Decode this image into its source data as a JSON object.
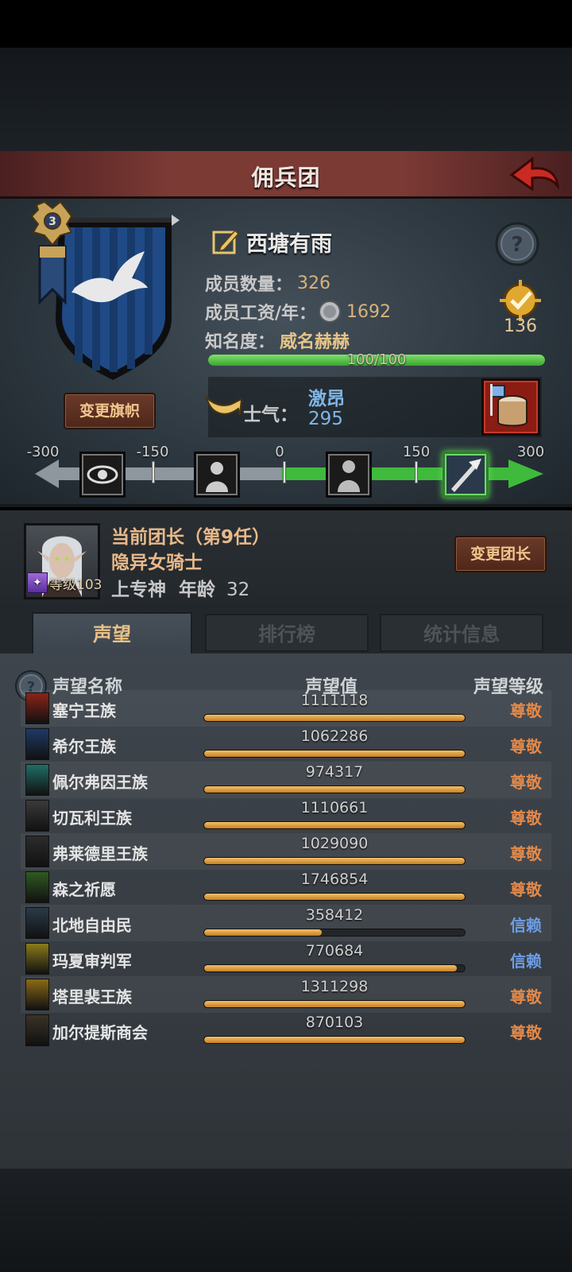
{
  "header": {
    "title": "佣兵团"
  },
  "guild": {
    "name": "西塘有雨",
    "members_label": "成员数量：",
    "members_value": "326",
    "salary_label": "成员工资/年：",
    "salary_value": "1692",
    "fame_label": "知名度：",
    "fame_value": "威名赫赫",
    "fame_progress_text": "100/100",
    "fame_progress": 1.0,
    "quest_count": "136",
    "change_flag_label": "变更旗帜",
    "banner_rank": "3"
  },
  "morale": {
    "label": "士气：",
    "state": "激昂",
    "value": "295",
    "scale_labels": [
      "-300",
      "-150",
      "0",
      "150",
      "300"
    ]
  },
  "leader": {
    "title": "当前团长（第9任）",
    "name": "隐异女骑士",
    "level_text": "等级103",
    "belief": "上专神",
    "age_label": "年龄",
    "age_value": "32",
    "change_leader_label": "变更团长"
  },
  "tabs": [
    {
      "label": "声望",
      "active": true
    },
    {
      "label": "排行榜",
      "active": false
    },
    {
      "label": "统计信息",
      "active": false
    }
  ],
  "reputation": {
    "columns": [
      "声望名称",
      "声望值",
      "声望等级"
    ],
    "rows": [
      {
        "name": "塞宁王族",
        "value": "1111118",
        "level": "尊敬",
        "fill": 1.0,
        "crest_color": "#8a2418"
      },
      {
        "name": "希尔王族",
        "value": "1062286",
        "level": "尊敬",
        "fill": 1.0,
        "crest_color": "#1e3a66"
      },
      {
        "name": "佩尔弗因王族",
        "value": "974317",
        "level": "尊敬",
        "fill": 1.0,
        "crest_color": "#1f6e66"
      },
      {
        "name": "切瓦利王族",
        "value": "1110661",
        "level": "尊敬",
        "fill": 1.0,
        "crest_color": "#3a3a3a"
      },
      {
        "name": "弗莱德里王族",
        "value": "1029090",
        "level": "尊敬",
        "fill": 1.0,
        "crest_color": "#2c2c2c"
      },
      {
        "name": "森之祈愿",
        "value": "1746854",
        "level": "尊敬",
        "fill": 1.0,
        "crest_color": "#2f5a22"
      },
      {
        "name": "北地自由民",
        "value": "358412",
        "level": "信赖",
        "fill": 0.45,
        "crest_color": "#2a3a4a"
      },
      {
        "name": "玛夏审判军",
        "value": "770684",
        "level": "信赖",
        "fill": 0.97,
        "crest_color": "#8a7a1a"
      },
      {
        "name": "塔里裴王族",
        "value": "1311298",
        "level": "尊敬",
        "fill": 1.0,
        "crest_color": "#8a6a14"
      },
      {
        "name": "加尔提斯商会",
        "value": "870103",
        "level": "尊敬",
        "fill": 1.0,
        "crest_color": "#3a3226"
      }
    ]
  }
}
